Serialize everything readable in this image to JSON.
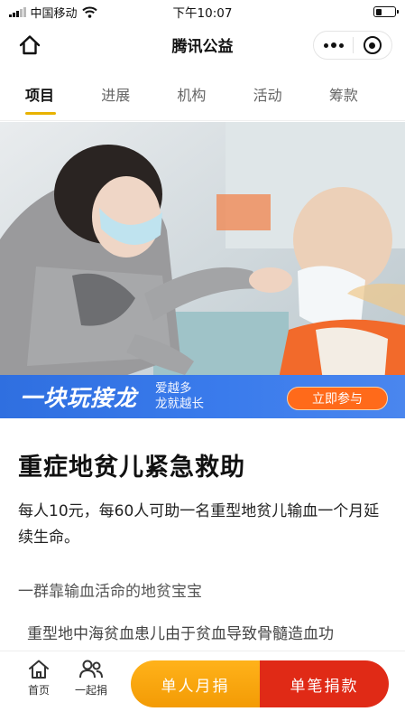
{
  "status_bar": {
    "carrier": "中国移动",
    "time": "下午10:07",
    "battery_level": 0.3
  },
  "title_bar": {
    "title": "腾讯公益",
    "home_icon": "home-icon",
    "more_icon": "more-dots-icon",
    "close_icon": "mini-program-close-icon"
  },
  "tabs": [
    {
      "label": "项目",
      "active": true
    },
    {
      "label": "进展",
      "active": false
    },
    {
      "label": "机构",
      "active": false
    },
    {
      "label": "活动",
      "active": false
    },
    {
      "label": "筹款",
      "active": false
    }
  ],
  "banner": {
    "title": "一块玩接龙",
    "sub_line1": "爱越多",
    "sub_line2": "龙就越长",
    "button": "立即参与"
  },
  "project": {
    "title": "重症地贫儿紧急救助",
    "description": "每人10元，每60人可助一名重型地贫儿输血一个月延续生命。",
    "section_heading": "一群靠输血活命的地贫宝宝",
    "paragraph_start": "重型地中海贫血患儿由于贫血导致骨髓造血功"
  },
  "bottom_bar": {
    "home_label": "首页",
    "together_label": "一起捐",
    "monthly_button": "单人月捐",
    "single_button": "单笔捐款"
  },
  "colors": {
    "accent": "#e8b200",
    "banner_blue": "#3a7bec",
    "join_orange": "#ff6a1a",
    "monthly_orange": "#f5a10a",
    "donate_red": "#e02a16"
  }
}
